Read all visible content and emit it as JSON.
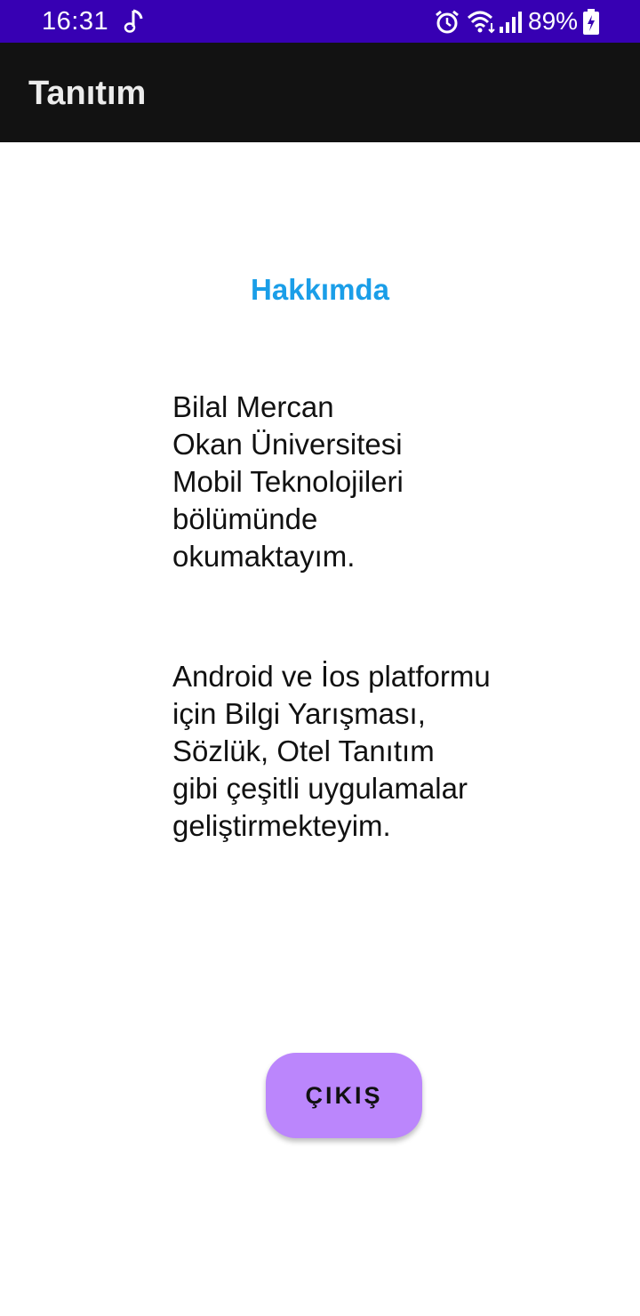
{
  "status_bar": {
    "time": "16:31",
    "battery": "89%"
  },
  "app_bar": {
    "title": "Tanıtım"
  },
  "content": {
    "heading": "Hakkımda",
    "intro": "Bilal Mercan\nOkan Üniversitesi\nMobil Teknolojileri\nbölümünde\nokumaktayım.",
    "skills": "Android ve İos platformu\niçin Bilgi Yarışması,\nSözlük, Otel Tanıtım\ngibi çeşitli uygulamalar\ngeliştirmekteyim."
  },
  "button": {
    "exit_label": "ÇIKIŞ"
  },
  "colors": {
    "status_bar": "#3700b3",
    "app_bar": "#121212",
    "heading": "#1a9ee8",
    "button": "#bb86fc"
  },
  "icons": [
    "music-note-icon",
    "alarm-icon",
    "wifi-icon",
    "signal-icon",
    "battery-charging-icon"
  ]
}
